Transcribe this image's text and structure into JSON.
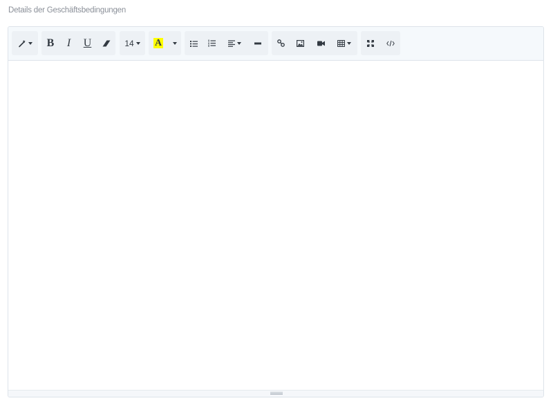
{
  "field": {
    "label": "Details der Geschäftsbedingungen"
  },
  "toolbar": {
    "style_icon": "magic-wand-icon",
    "bold_label": "B",
    "italic_label": "I",
    "underline_label": "U",
    "clear_icon": "eraser-icon",
    "font_size": "14",
    "color_label": "A",
    "highlight_color": "#ffff00",
    "unordered_list_icon": "unordered-list-icon",
    "ordered_list_icon": "ordered-list-icon",
    "paragraph_icon": "align-left-icon",
    "hr_icon": "horizontal-rule-icon",
    "link_icon": "link-icon",
    "picture_icon": "image-icon",
    "video_icon": "video-icon",
    "table_icon": "table-icon",
    "fullscreen_icon": "fullscreen-icon",
    "codeview_icon": "code-view-icon"
  },
  "editor": {
    "content": ""
  }
}
